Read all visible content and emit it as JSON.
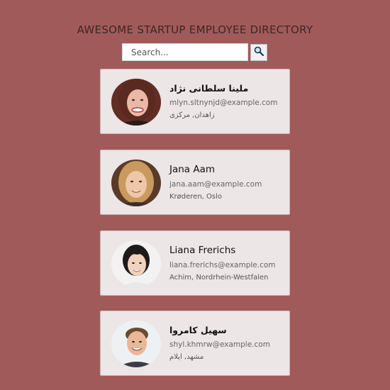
{
  "header": {
    "title": "AWESOME STARTUP EMPLOYEE DIRECTORY"
  },
  "search": {
    "placeholder": "Search...",
    "value": "",
    "button_icon": "search-icon"
  },
  "employees": [
    {
      "name": "ملینا سلطانی نژاد",
      "email": "mlyn.sltnynjd@example.com",
      "location": "زاهدان, مرکزی",
      "avatar": "photo-woman-brown-hair"
    },
    {
      "name": "Jana Aam",
      "email": "jana.aam@example.com",
      "location": "Krøderen, Oslo",
      "avatar": "photo-woman-blonde"
    },
    {
      "name": "Liana Frerichs",
      "email": "liana.frerichs@example.com",
      "location": "Achim, Nordrhein-Westfalen",
      "avatar": "photo-woman-dark-hair"
    },
    {
      "name": "سهیل کامروا",
      "email": "shyl.khmrw@example.com",
      "location": "مشهد, ایلام",
      "avatar": "photo-man-short-hair"
    }
  ],
  "colors": {
    "background": "#a15a5a",
    "card": "#ece6e6",
    "title": "#3f2626"
  }
}
